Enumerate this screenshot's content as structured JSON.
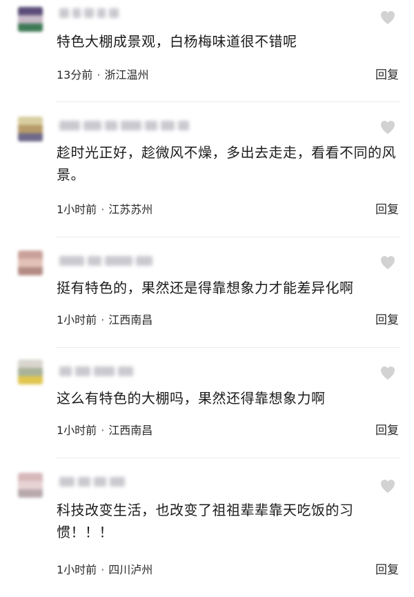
{
  "comments": [
    {
      "text": "特色大棚成景观，白杨梅味道很不错呢",
      "time": "13分前",
      "location": "浙江温州",
      "reply": "回复",
      "avatar_colors": [
        "#5a4e78",
        "#c7b9c6",
        "#3f7a56"
      ],
      "name_blocks": [
        14,
        12,
        14,
        12,
        14
      ]
    },
    {
      "text": "趁时光正好，趁微风不燥，多出去走走，看看不同的风景。",
      "time": "1小时前",
      "location": "江苏苏州",
      "reply": "回复",
      "avatar_colors": [
        "#d8cda0",
        "#b79b6a",
        "#6e6a8a"
      ],
      "name_blocks": [
        30,
        26,
        18,
        30,
        18,
        20,
        16
      ]
    },
    {
      "text": "挺有特色的，果然还是得靠想象力才能差异化啊",
      "time": "1小时前",
      "location": "江西南昌",
      "reply": "回复",
      "avatar_colors": [
        "#caa29a",
        "#e2c2b8",
        "#b48c86"
      ],
      "name_blocks": [
        36,
        20,
        40,
        24
      ]
    },
    {
      "text": "这么有特色的大棚吗，果然还得靠想象力啊",
      "time": "1小时前",
      "location": "江西南昌",
      "reply": "回复",
      "avatar_colors": [
        "#d9d5cf",
        "#a9b39a",
        "#e0c64e"
      ],
      "name_blocks": [
        18,
        22,
        30,
        22
      ]
    },
    {
      "text": "科技改变生活，也改变了祖祖辈辈靠天吃饭的习惯！！！",
      "time": "1小时前",
      "location": "四川泸州",
      "reply": "回复",
      "avatar_colors": [
        "#d7b9bc",
        "#e8d3d3",
        "#b7a9ac"
      ],
      "name_blocks": [
        22,
        18,
        18,
        22
      ]
    }
  ],
  "colors": {
    "text": "#1b1b1b",
    "meta": "#2a2a2a",
    "divider": "#ececec",
    "like_icon": "#d2d2d2"
  },
  "icons": {
    "like": "heart-icon"
  }
}
